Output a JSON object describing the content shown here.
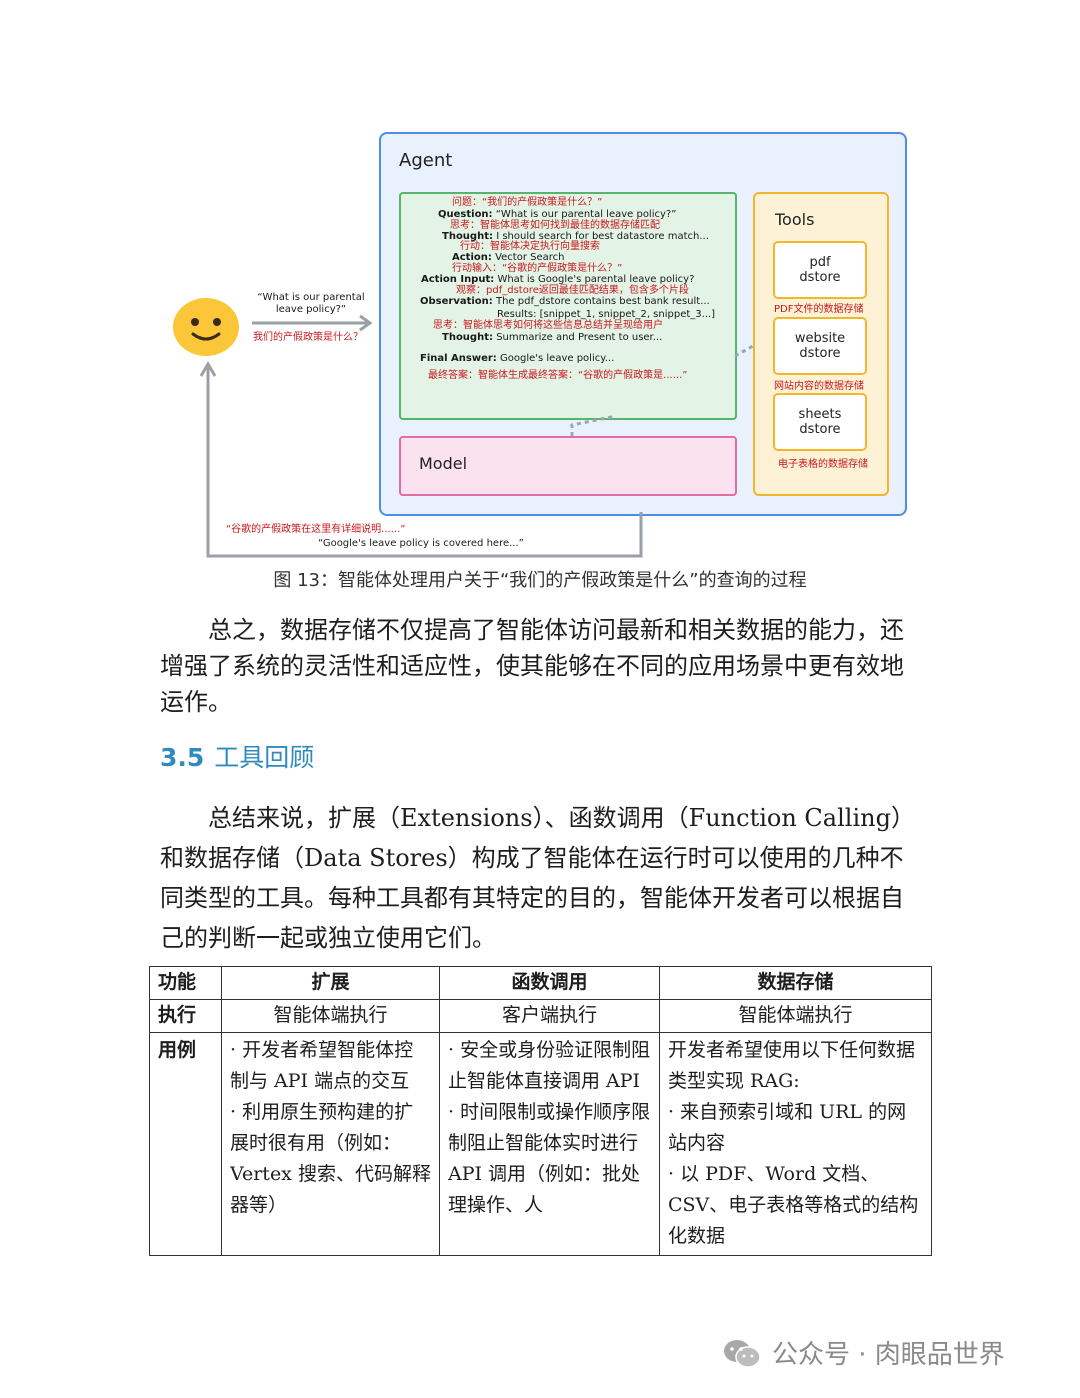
{
  "figure": {
    "agent_title": "Agent",
    "model_label": "Model",
    "tools_title": "Tools",
    "tools": [
      {
        "label": "pdf\ndstore",
        "cn": "PDF文件的数据存储"
      },
      {
        "label": "website\ndstore",
        "cn": "网站内容的数据存储"
      },
      {
        "label": "sheets\ndstore",
        "cn": "电子表格的数据存储"
      }
    ],
    "trace": {
      "cn_question": "问题：“我们的产假政策是什么？”",
      "question_key": "Question:",
      "question_val": "“What is our parental leave policy?”",
      "cn_thought1": "思考：智能体思考如何找到最佳的数据存储匹配",
      "thought1_key": "Thought:",
      "thought1_val": "I should search for best datastore match...",
      "cn_action": "行动：智能体决定执行向量搜索",
      "action_key": "Action:",
      "action_val": "Vector Search",
      "cn_action_input": "行动输入：“谷歌的产假政策是什么？”",
      "action_input_key": "Action Input:",
      "action_input_val": "What is Google's parental leave policy?",
      "cn_observation": "观察：pdf_dstore返回最佳匹配结果，包含多个片段",
      "observation_key": "Observation:",
      "observation_val": "The pdf_dstore contains best bank result...",
      "results_val": "Results: [snippet_1, snippet_2, snippet_3...]",
      "cn_thought2": "思考：智能体思考如何将这些信息总结并呈现给用户",
      "thought2_key": "Thought:",
      "thought2_val": "Summarize and Present to user...",
      "final_key": "Final Answer:",
      "final_val": "Google's leave policy...",
      "cn_final": "最终答案：智能体生成最终答案：“谷歌的产假政策是......”"
    },
    "user_query_en": "“What is our parental\nleave policy?”",
    "user_query_cn": "我们的产假政策是什么？",
    "response_cn": "“谷歌的产假政策在这里有详细说明......”",
    "response_en": "“Google's leave policy is covered here...”"
  },
  "caption": "图 13：智能体处理用户关于“我们的产假政策是什么”的查询的过程",
  "paragraph1": "总之，数据存储不仅提高了智能体访问最新和相关数据的能力，还增强了系统的灵活性和适应性，使其能够在不同的应用场景中更有效地运作。",
  "section": {
    "number": "3.5",
    "title": "工具回顾"
  },
  "paragraph2": "总结来说，扩展（Extensions）、函数调用（Function Calling）和数据存储（Data Stores）构成了智能体在运行时可以使用的几种不同类型的工具。每种工具都有其特定的目的，智能体开发者可以根据自己的判断一起或独立使用它们。",
  "table": {
    "headers": [
      "功能",
      "扩展",
      "函数调用",
      "数据存储"
    ],
    "exec": [
      "执行",
      "智能体端执行",
      "客户端执行",
      "智能体端执行"
    ],
    "usecase_label": "用例",
    "ext_1": "· 开发者希望智能体控制与 API 端点的交互",
    "ext_2": "· 利用原生预构建的扩展时很有用（例如：Vertex 搜索、代码解释器等）",
    "fn_1": "· 安全或身份验证限制阻止智能体直接调用 API",
    "fn_2": "· 时间限制或操作顺序限制阻止智能体实时进行 API 调用（例如：批处理操作、人",
    "ds_0": "开发者希望使用以下任何数据类型实现 RAG:",
    "ds_1": "· 来自预索引域和 URL 的网站内容",
    "ds_2": "· 以 PDF、Word 文档、CSV、电子表格等格式的结构化数据"
  },
  "watermark": "公众号 · 肉眼品世界"
}
